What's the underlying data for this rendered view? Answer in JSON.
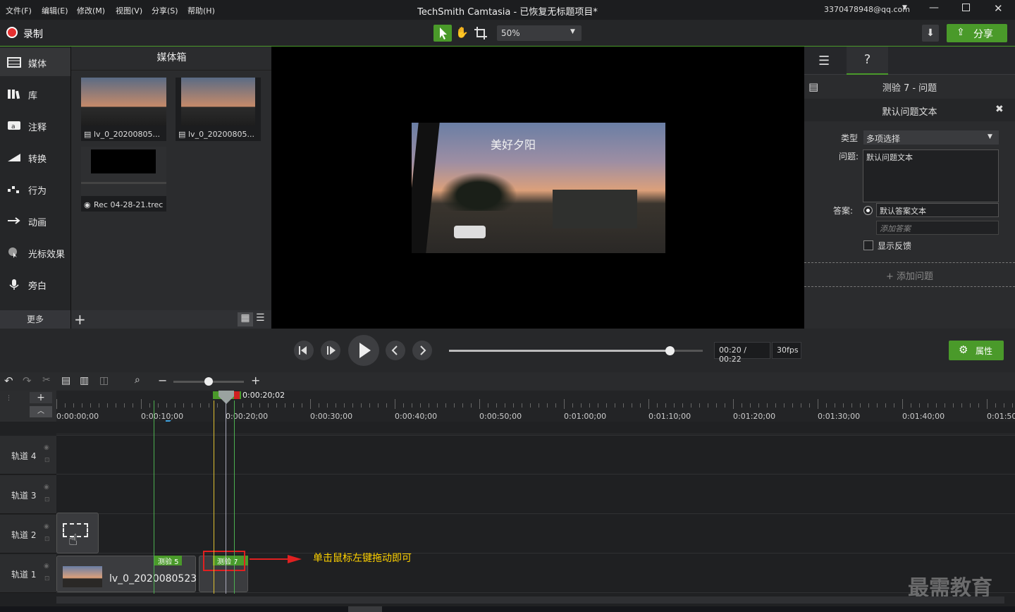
{
  "titlebar": {
    "menus": [
      "文件(F)",
      "编辑(E)",
      "修改(M)",
      "视图(V)",
      "分享(S)",
      "帮助(H)"
    ],
    "title": "TechSmith Camtasia - 已恢复无标题项目*",
    "account": "3370478948@qq.com"
  },
  "toolbar": {
    "record": "录制",
    "zoom": "50%",
    "share": "分享"
  },
  "nav": {
    "items": [
      "媒体",
      "库",
      "注释",
      "转换",
      "行为",
      "动画",
      "光标效果",
      "旁白"
    ],
    "more": "更多"
  },
  "mediabin": {
    "title": "媒体箱",
    "items": [
      "lv_0_20200805...",
      "lv_0_20200805...",
      "Rec 04-28-21.trec"
    ]
  },
  "canvas": {
    "overlay_text": "美好夕阳"
  },
  "quiz": {
    "header": "测验 7 - 问题",
    "subheader": "默认问题文本",
    "type_label": "类型",
    "type_value": "多项选择",
    "question_label": "问题:",
    "question_value": "默认问题文本",
    "answer_label": "答案:",
    "answer_value": "默认答案文本",
    "add_answer_placeholder": "添加答案",
    "show_feedback": "显示反馈",
    "add_question": "+ 添加问题"
  },
  "playback": {
    "time": "00:20 / 00:22",
    "fps": "30fps",
    "properties": "属性",
    "progress": 0.87
  },
  "timeline": {
    "playhead": "0:00:20;02",
    "ticks": [
      "0:00:00;00",
      "0:00:10;00",
      "0:00:20;00",
      "0:00:30;00",
      "0:00:40;00",
      "0:00:50;00",
      "0:01:00;00",
      "0:01:10;00",
      "0:01:20;00",
      "0:01:30;00",
      "0:01:40;00",
      "0:01:50;"
    ],
    "quiz_track": "测验",
    "tracks": [
      "轨道 4",
      "轨道 3",
      "轨道 2",
      "轨道 1"
    ],
    "clip_label": "lv_0_2020080523",
    "quiz5": "测验 5",
    "quiz7": "测验 7"
  },
  "annotation": {
    "text": "单击鼠标左键拖动即可"
  },
  "watermark": "最需教育",
  "colors": {
    "accent": "#4a9a2a",
    "highlight": "#e02020",
    "annotation": "#ffd200"
  }
}
